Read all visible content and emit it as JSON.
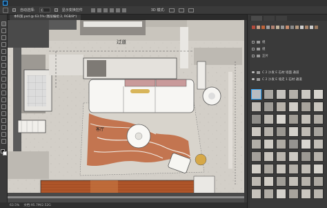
{
  "menubar": {
    "items": [
      "",
      "",
      "",
      "",
      "",
      "",
      "",
      "",
      "",
      "",
      ""
    ]
  },
  "optionsbar": {
    "autoselect_label": "自动选择:",
    "autoselect_value": "组",
    "transform_label": "显示变换控件",
    "mode3d_label": "3D 模式:"
  },
  "document": {
    "tab_label": "本科案.psd @ 63.5% (图层编组 2, RGB/8*)"
  },
  "canvas": {
    "label_corridor": "过道",
    "label_living": "客厅"
  },
  "statusbar": {
    "zoom": "63.5%",
    "doc_info": "文档:95.7M/2.52G"
  },
  "panel": {
    "layers": [
      {
        "name": "组",
        "type": "folder"
      },
      {
        "name": "组",
        "type": "folder"
      },
      {
        "name": "正片",
        "type": "folder"
      },
      {
        "name": "C 2 沙发 E 石材 墙面 通道",
        "type": "group"
      },
      {
        "name": "C 2 沙发 E 墙走 1 石材 通道",
        "type": "group"
      }
    ]
  },
  "colors": {
    "accent": "#31a8ff",
    "wall_dark": "#4a4a4a",
    "rug_orange": "#c0643a",
    "sofa_pink": "#c99a9a",
    "floor": "#d6d2cb",
    "wood_floor": "#b0562a"
  }
}
